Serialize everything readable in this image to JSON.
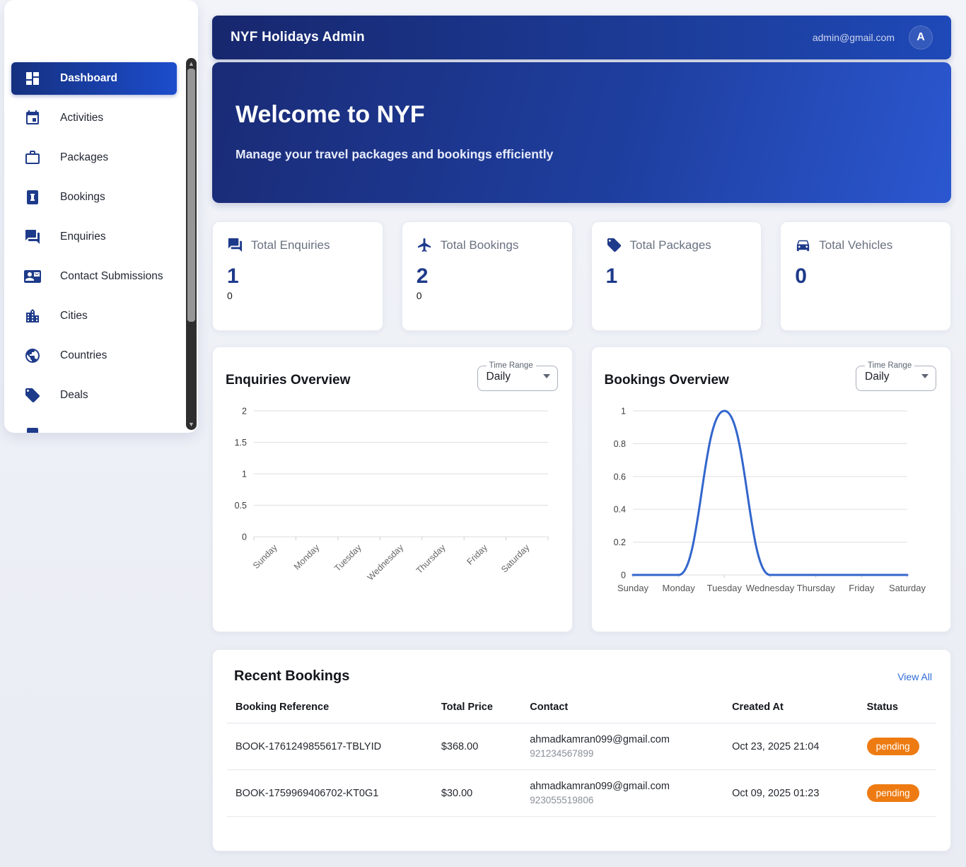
{
  "header": {
    "title": "NYF Holidays Admin",
    "user_email": "admin@gmail.com",
    "avatar_letter": "A"
  },
  "sidebar": {
    "items": [
      {
        "label": "Dashboard",
        "icon": "dashboard",
        "active": true
      },
      {
        "label": "Activities",
        "icon": "event",
        "active": false
      },
      {
        "label": "Packages",
        "icon": "briefcase",
        "active": false
      },
      {
        "label": "Bookings",
        "icon": "book",
        "active": false
      },
      {
        "label": "Enquiries",
        "icon": "forum",
        "active": false
      },
      {
        "label": "Contact Submissions",
        "icon": "contact-mail",
        "active": false
      },
      {
        "label": "Cities",
        "icon": "city",
        "active": false
      },
      {
        "label": "Countries",
        "icon": "globe",
        "active": false
      },
      {
        "label": "Deals",
        "icon": "tag",
        "active": false
      },
      {
        "label": "",
        "icon": "partial",
        "active": false
      }
    ]
  },
  "banner": {
    "title": "Welcome to NYF",
    "subtitle": "Manage your travel packages and bookings efficiently"
  },
  "stats": [
    {
      "label": "Total Enquiries",
      "icon": "forum",
      "value": "1",
      "sub": "0"
    },
    {
      "label": "Total Bookings",
      "icon": "flight",
      "value": "2",
      "sub": "0"
    },
    {
      "label": "Total Packages",
      "icon": "tag",
      "value": "1",
      "sub": ""
    },
    {
      "label": "Total Vehicles",
      "icon": "car",
      "value": "0",
      "sub": ""
    }
  ],
  "chart_data": [
    {
      "type": "line",
      "title": "Enquiries Overview",
      "time_range_label": "Time Range",
      "time_range": "Daily",
      "categories": [
        "Sunday",
        "Monday",
        "Tuesday",
        "Wednesday",
        "Thursday",
        "Friday",
        "Saturday"
      ],
      "values": [
        0,
        0,
        0,
        0,
        0,
        0,
        0
      ],
      "show_line": false,
      "y_ticks": [
        0,
        0.5,
        1,
        1.5,
        2
      ],
      "ylim": [
        0,
        2
      ],
      "x_label_rotation": -45,
      "grid": true,
      "line_color": "#3366cc"
    },
    {
      "type": "line",
      "title": "Bookings Overview",
      "time_range_label": "Time Range",
      "time_range": "Daily",
      "categories": [
        "Sunday",
        "Monday",
        "Tuesday",
        "Wednesday",
        "Thursday",
        "Friday",
        "Saturday"
      ],
      "values": [
        0,
        0,
        1,
        0,
        0,
        0,
        0
      ],
      "show_line": true,
      "y_ticks": [
        0,
        0.2,
        0.4,
        0.6,
        0.8,
        1
      ],
      "ylim": [
        0,
        1
      ],
      "x_label_rotation": 0,
      "grid": true,
      "line_color": "#3366cc"
    }
  ],
  "recent_bookings": {
    "title": "Recent Bookings",
    "view_all_label": "View All",
    "columns": [
      "Booking Reference",
      "Total Price",
      "Contact",
      "Created At",
      "Status"
    ],
    "rows": [
      {
        "reference": "BOOK-1761249855617-TBLYID",
        "total_price": "$368.00",
        "contact_email": "ahmadkamran099@gmail.com",
        "contact_phone": "921234567899",
        "created_at": "Oct 23, 2025 21:04",
        "status": "pending"
      },
      {
        "reference": "BOOK-1759969406702-KT0G1",
        "total_price": "$30.00",
        "contact_email": "ahmadkamran099@gmail.com",
        "contact_phone": "923055519806",
        "created_at": "Oct 09, 2025 01:23",
        "status": "pending"
      }
    ]
  },
  "colors": {
    "accent_navy": "#1e3a8a",
    "header_gradient_start": "#17276e",
    "header_gradient_end": "#1e49b8",
    "chart_line": "#3366cc",
    "status_pending": "#ed7b12",
    "link_blue": "#2e6bd6"
  }
}
